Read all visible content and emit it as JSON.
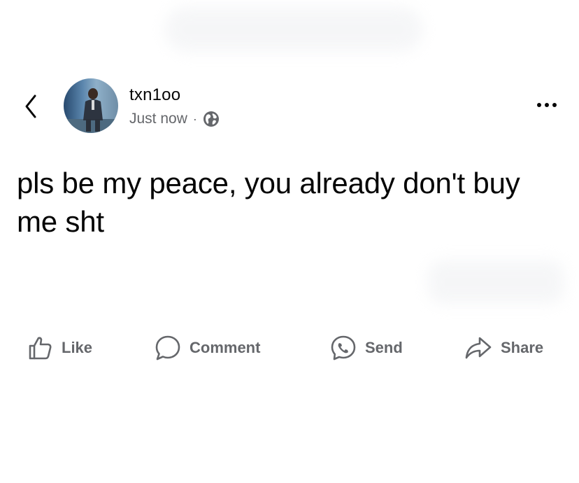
{
  "post": {
    "author": "txn1oo",
    "timestamp": "Just now",
    "separator": "·",
    "privacy_icon": "globe-icon",
    "text": "pls be my peace, you already don't buy me sht"
  },
  "header": {
    "back_icon": "chevron-left-icon",
    "more_icon": "more-horizontal-icon"
  },
  "actions": [
    {
      "label": "Like",
      "icon": "thumbs-up-icon"
    },
    {
      "label": "Comment",
      "icon": "comment-icon"
    },
    {
      "label": "Send",
      "icon": "messenger-icon"
    },
    {
      "label": "Share",
      "icon": "share-icon"
    }
  ],
  "colors": {
    "text": "#050505",
    "secondary": "#65676b",
    "background": "#ffffff"
  }
}
